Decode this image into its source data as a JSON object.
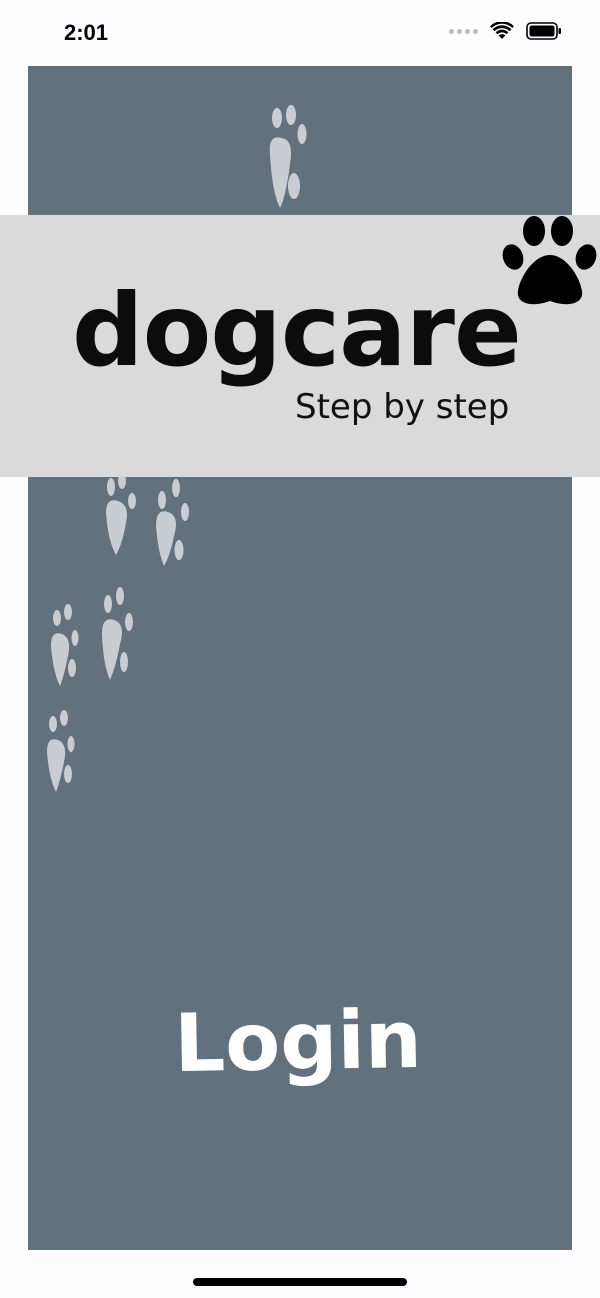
{
  "status_bar": {
    "time": "2:01",
    "icons": [
      "signal-dots-icon",
      "wifi-icon",
      "battery-icon"
    ]
  },
  "banner": {
    "brand_name": "dogcare",
    "tagline": "Step by step",
    "logo_icon": "paw-icon"
  },
  "login": {
    "label": "Login"
  },
  "colors": {
    "screen_background": "#61717d",
    "banner_background": "#dbdada",
    "paw_print": "#c9cdd1",
    "text_dark": "#0c0c0c",
    "login_text": "#ffffff"
  }
}
